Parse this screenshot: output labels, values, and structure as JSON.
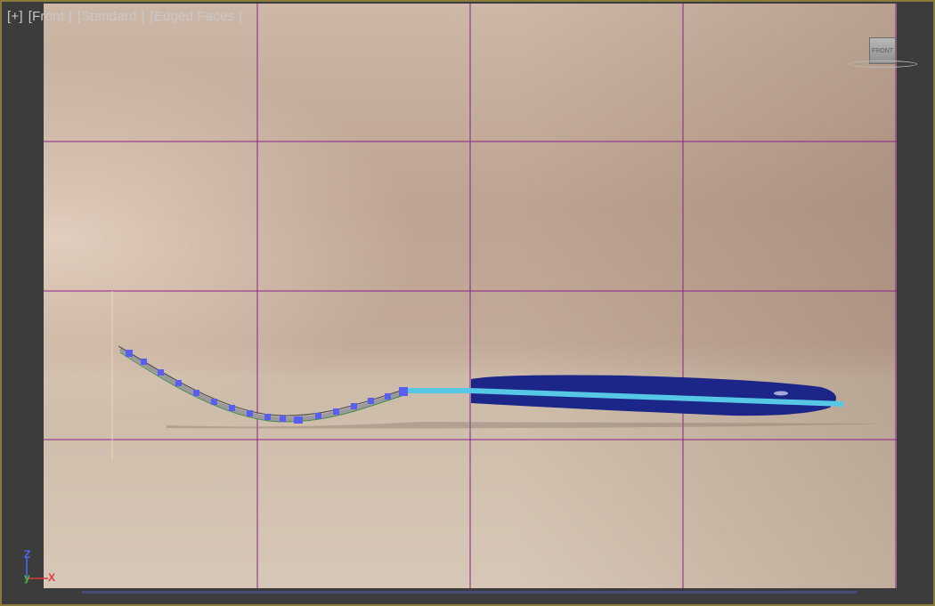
{
  "viewport": {
    "labels": {
      "plus": "[+]",
      "view": "[Front ]",
      "shading": "[Standard ]",
      "display": "[Edged Faces ]"
    },
    "viewcube": {
      "face_label": "FRONT"
    },
    "axis": {
      "z": "Z",
      "y": "y",
      "x": "X"
    }
  },
  "colors": {
    "grid": "#8c1f8c",
    "spline": "#56c8e6",
    "vertex": "#5a5ef0",
    "handle": "#1c2588",
    "frame": "#8a7a3c"
  }
}
